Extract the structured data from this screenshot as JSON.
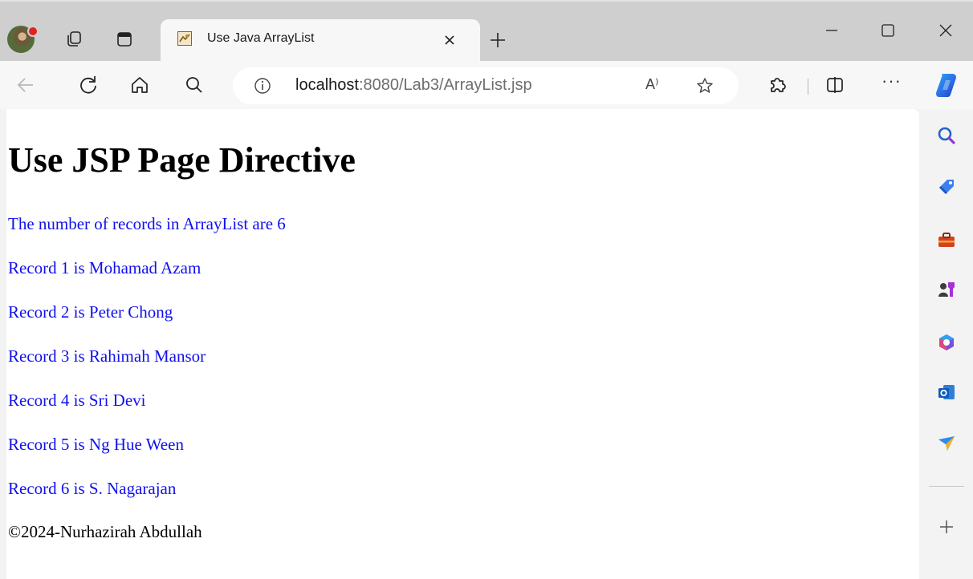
{
  "browser": {
    "tab": {
      "title": "Use Java ArrayList"
    },
    "address": {
      "host": "localhost",
      "path": ":8080/Lab3/ArrayList.jsp"
    },
    "readaloud_label": "A⁾",
    "more_label": "···"
  },
  "page": {
    "heading": "Use JSP Page Directive",
    "records": [
      "The number of records in ArrayList are 6",
      "Record 1 is Mohamad Azam",
      "Record 2 is Peter Chong",
      "Record 3 is Rahimah Mansor",
      "Record 4 is Sri Devi",
      "Record 5 is Ng Hue Ween",
      "Record 6 is S. Nagarajan"
    ],
    "footer": "©2024-Nurhazirah Abdullah"
  },
  "colors": {
    "record_text": "#1010ee",
    "chrome": "#cfcfcf",
    "toolbar": "#f7f7f7"
  }
}
